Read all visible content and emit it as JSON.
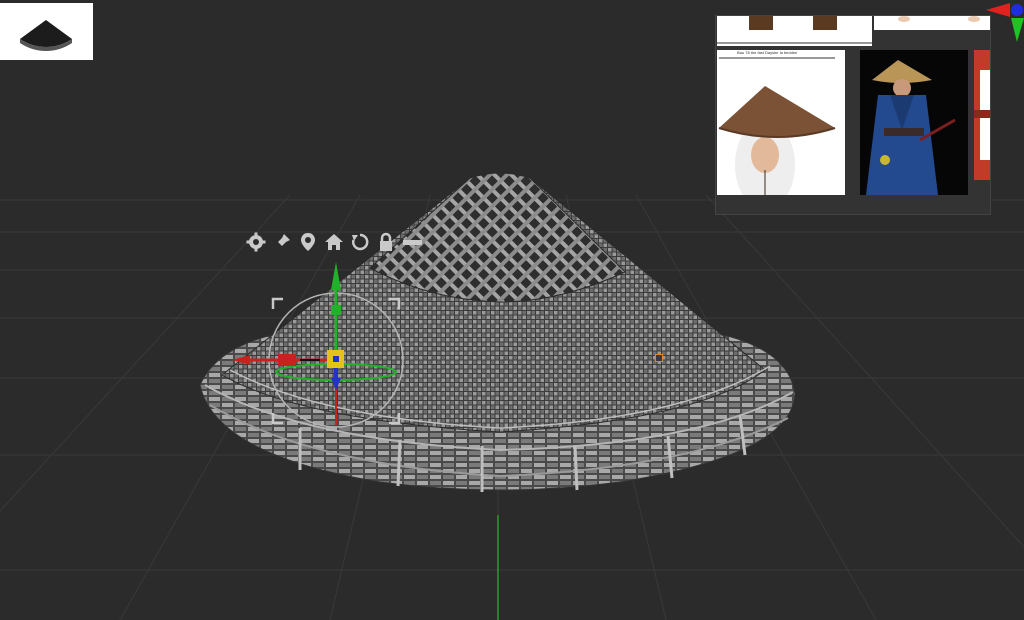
{
  "viewport": {
    "background": "#2b2b2b",
    "grid_color": "#393939",
    "axis_green": "#23a125"
  },
  "thumbnail": {
    "icon": "conical-hat-thumbnail",
    "background": "#ffffff"
  },
  "reference_panel": {
    "images": [
      {
        "name": "reference-legs-photo",
        "description_icon": "photo"
      },
      {
        "name": "reference-hands-photo",
        "description_icon": "photo"
      },
      {
        "name": "reference-person-in-straw-hat",
        "description_icon": "photo"
      },
      {
        "name": "reference-samurai-in-blue-robe",
        "description_icon": "photo"
      },
      {
        "name": "reference-red-gate",
        "description_icon": "photo"
      }
    ],
    "doc_caption": "Bau 78 the fast Daysler la bedden"
  },
  "gizmo_toolbar": {
    "icons": [
      "gear-icon",
      "pin-icon",
      "location-icon",
      "home-icon",
      "reset-icon",
      "lock-icon",
      "minus-icon"
    ]
  },
  "transform_gizmo": {
    "x_axis_color": "#c8221e",
    "y_axis_color": "#22b12a",
    "z_axis_color": "#2333c8",
    "center_color": "#e5c21a"
  },
  "orientation_gizmo": {
    "x_color": "#e0231e",
    "y_color": "#1fc222",
    "z_color": "#1f2ce0"
  },
  "model": {
    "name": "woven-conical-hat",
    "color": "#8a8a8a"
  }
}
